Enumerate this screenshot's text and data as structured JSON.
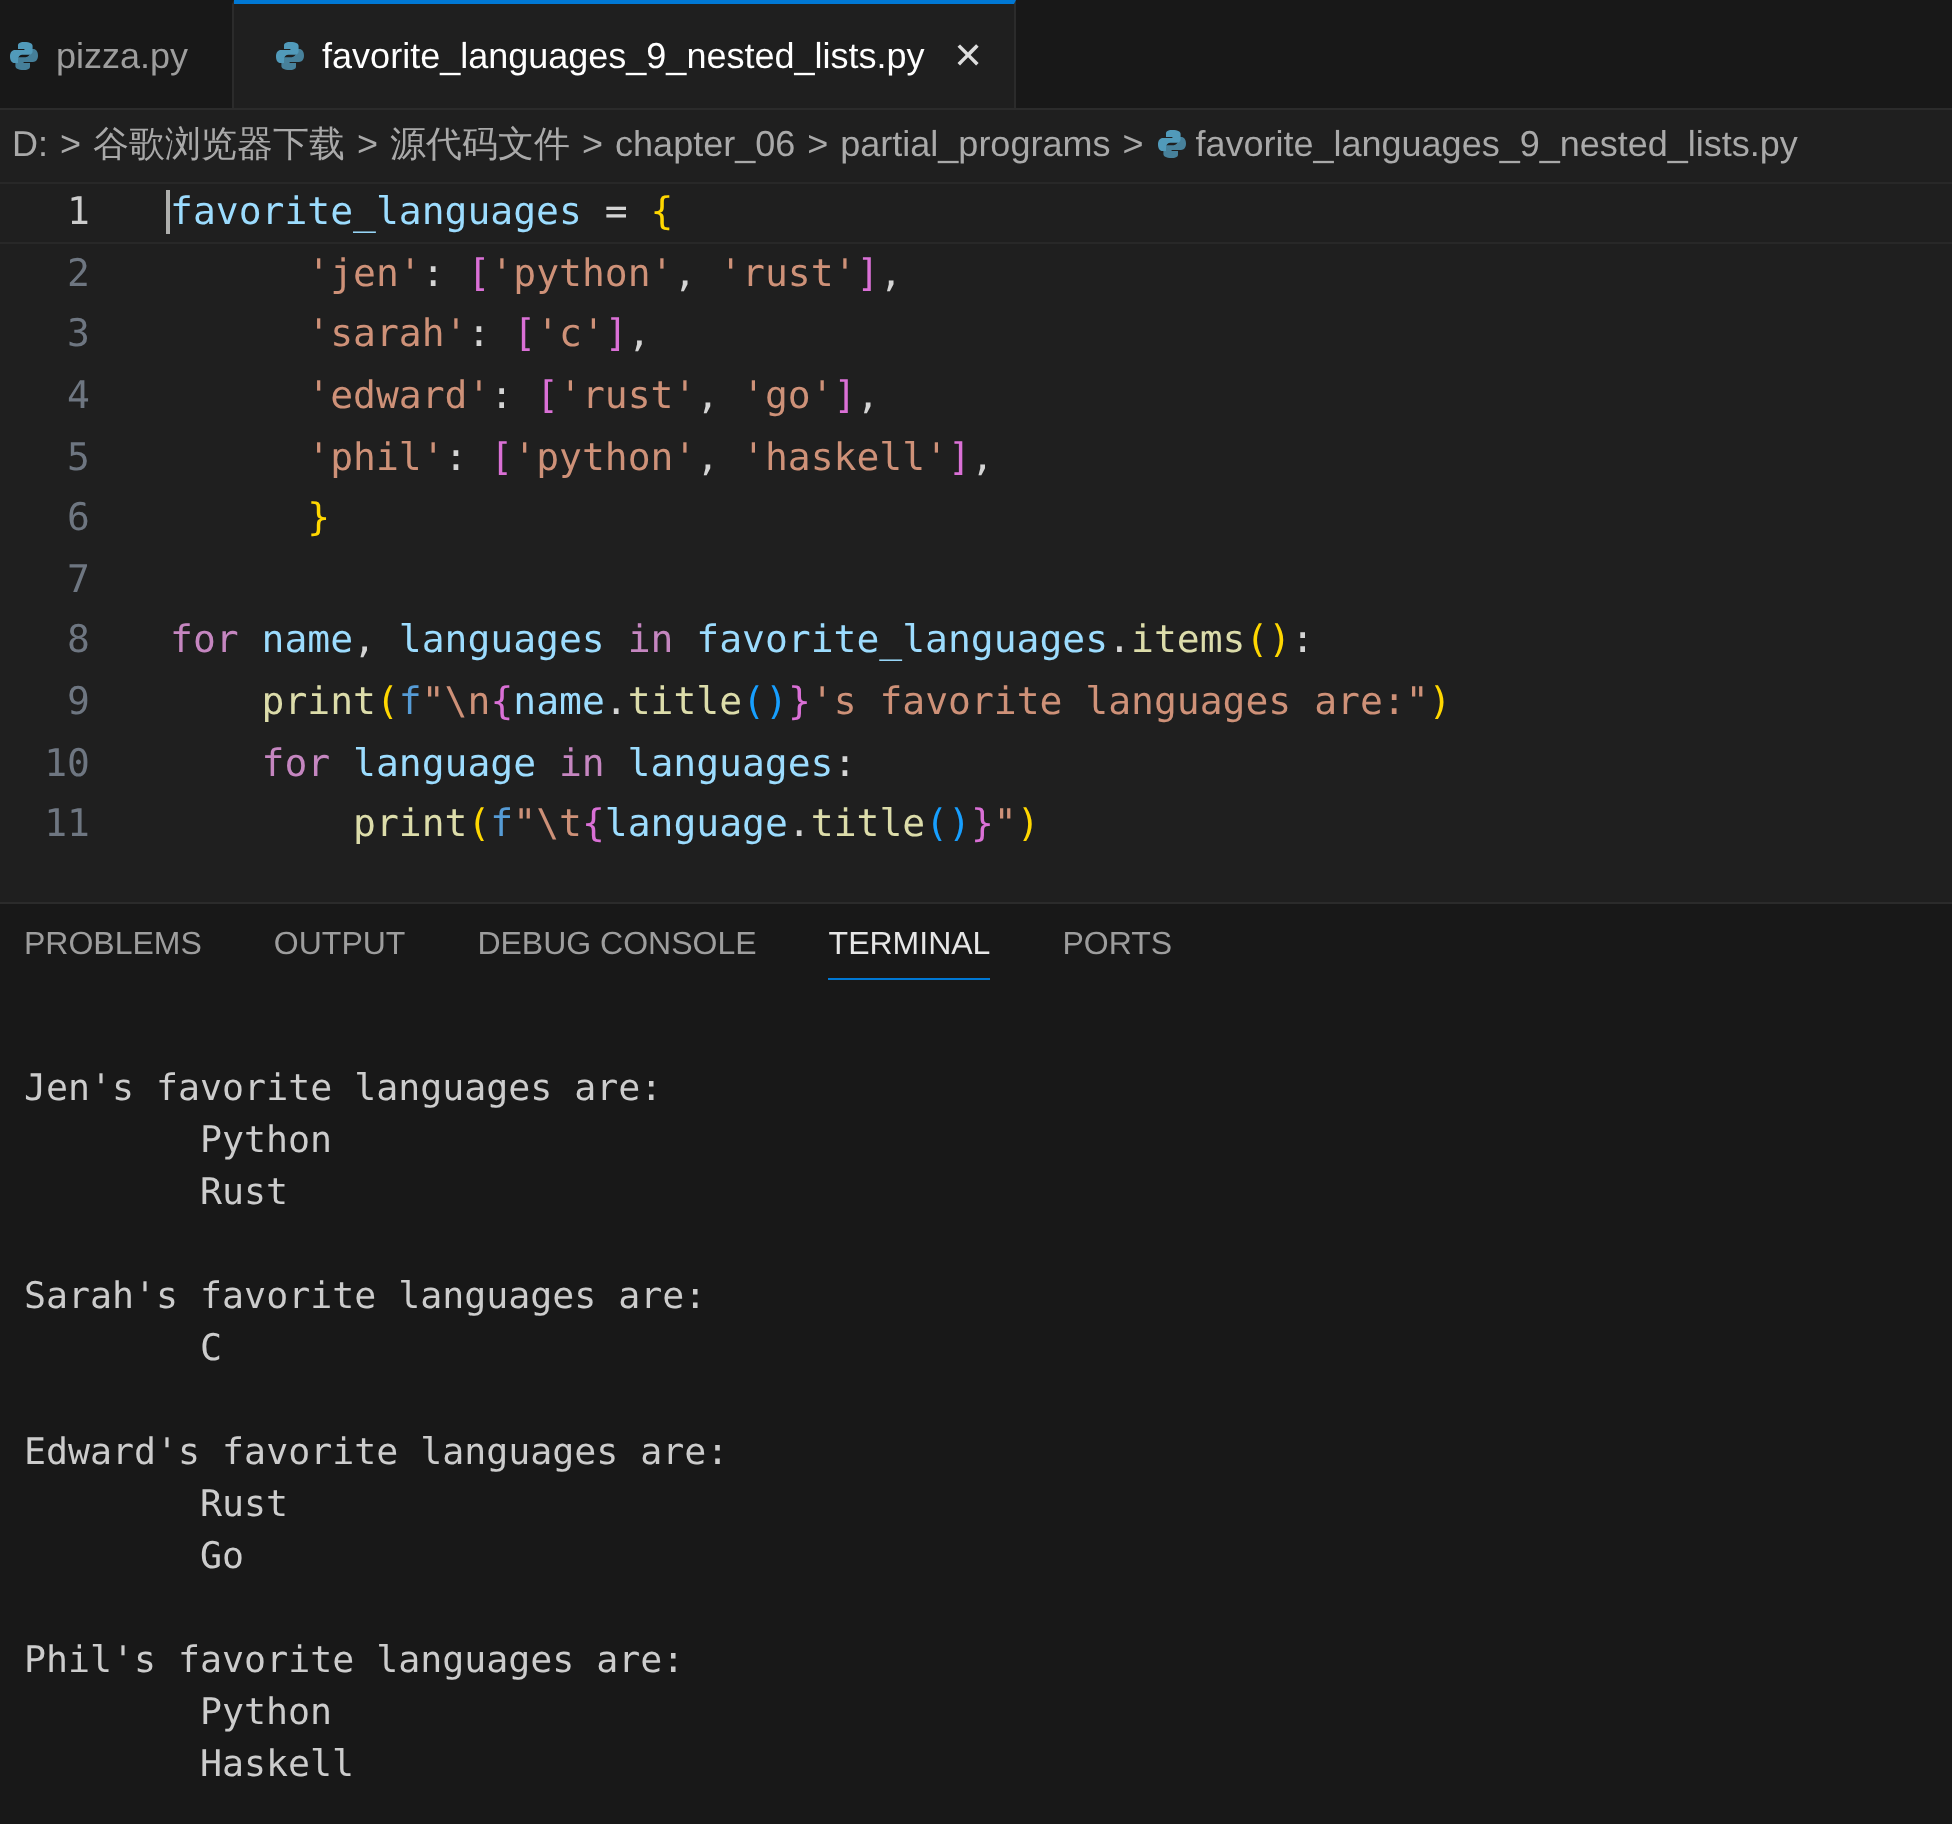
{
  "tabs": [
    {
      "label": "pizza.py",
      "selected": false
    },
    {
      "label": "favorite_languages_9_nested_lists.py",
      "selected": true,
      "close": "✕"
    }
  ],
  "breadcrumbs": [
    {
      "label": "D:",
      "kind": "folder"
    },
    {
      "label": "谷歌浏览器下载",
      "kind": "folder"
    },
    {
      "label": "源代码文件",
      "kind": "folder"
    },
    {
      "label": "chapter_06",
      "kind": "folder"
    },
    {
      "label": "partial_programs",
      "kind": "folder"
    },
    {
      "label": "favorite_languages_9_nested_lists.py",
      "kind": "file"
    }
  ],
  "breadcrumb_separator": ">",
  "editor": {
    "lines": [
      {
        "number": "1",
        "current": true,
        "tokens": [
          {
            "kind": "var",
            "text": "favorite_languages"
          },
          {
            "kind": "op",
            "text": " = "
          },
          {
            "kind": "b1",
            "text": "{"
          }
        ]
      },
      {
        "number": "2",
        "current": false,
        "tokens": [
          {
            "kind": "str",
            "text": "      'jen'"
          },
          {
            "kind": "op",
            "text": ": "
          },
          {
            "kind": "b2",
            "text": "["
          },
          {
            "kind": "str",
            "text": "'python'"
          },
          {
            "kind": "op",
            "text": ", "
          },
          {
            "kind": "str",
            "text": "'rust'"
          },
          {
            "kind": "b2",
            "text": "]"
          },
          {
            "kind": "op",
            "text": ","
          }
        ]
      },
      {
        "number": "3",
        "current": false,
        "tokens": [
          {
            "kind": "str",
            "text": "      'sarah'"
          },
          {
            "kind": "op",
            "text": ": "
          },
          {
            "kind": "b2",
            "text": "["
          },
          {
            "kind": "str",
            "text": "'c'"
          },
          {
            "kind": "b2",
            "text": "]"
          },
          {
            "kind": "op",
            "text": ","
          }
        ]
      },
      {
        "number": "4",
        "current": false,
        "tokens": [
          {
            "kind": "str",
            "text": "      'edward'"
          },
          {
            "kind": "op",
            "text": ": "
          },
          {
            "kind": "b2",
            "text": "["
          },
          {
            "kind": "str",
            "text": "'rust'"
          },
          {
            "kind": "op",
            "text": ", "
          },
          {
            "kind": "str",
            "text": "'go'"
          },
          {
            "kind": "b2",
            "text": "]"
          },
          {
            "kind": "op",
            "text": ","
          }
        ]
      },
      {
        "number": "5",
        "current": false,
        "tokens": [
          {
            "kind": "str",
            "text": "      'phil'"
          },
          {
            "kind": "op",
            "text": ": "
          },
          {
            "kind": "b2",
            "text": "["
          },
          {
            "kind": "str",
            "text": "'python'"
          },
          {
            "kind": "op",
            "text": ", "
          },
          {
            "kind": "str",
            "text": "'haskell'"
          },
          {
            "kind": "b2",
            "text": "]"
          },
          {
            "kind": "op",
            "text": ","
          }
        ]
      },
      {
        "number": "6",
        "current": false,
        "tokens": [
          {
            "kind": "b1",
            "text": "      }"
          }
        ]
      },
      {
        "number": "7",
        "current": false
      },
      {
        "number": "8",
        "current": false,
        "tokens": [
          {
            "kind": "kw",
            "text": "for "
          },
          {
            "kind": "var",
            "text": "name"
          },
          {
            "kind": "op",
            "text": ", "
          },
          {
            "kind": "var",
            "text": "languages "
          },
          {
            "kind": "kw",
            "text": "in "
          },
          {
            "kind": "var",
            "text": "favorite_languages"
          },
          {
            "kind": "op",
            "text": "."
          },
          {
            "kind": "fn",
            "text": "items"
          },
          {
            "kind": "b1",
            "text": "()"
          },
          {
            "kind": "op",
            "text": ":"
          }
        ]
      },
      {
        "number": "9",
        "current": false,
        "tokens": [
          {
            "kind": "fn",
            "text": "    print"
          },
          {
            "kind": "b1",
            "text": "("
          },
          {
            "kind": "pre",
            "text": "f"
          },
          {
            "kind": "str",
            "text": "\"\\n"
          },
          {
            "kind": "b2",
            "text": "{"
          },
          {
            "kind": "var",
            "text": "name"
          },
          {
            "kind": "op",
            "text": "."
          },
          {
            "kind": "fn",
            "text": "title"
          },
          {
            "kind": "b3",
            "text": "()"
          },
          {
            "kind": "b2",
            "text": "}"
          },
          {
            "kind": "str",
            "text": "'s favorite languages are:\""
          },
          {
            "kind": "b1",
            "text": ")"
          }
        ]
      },
      {
        "number": "10",
        "current": false,
        "tokens": [
          {
            "kind": "kw",
            "text": "    for "
          },
          {
            "kind": "var",
            "text": "language "
          },
          {
            "kind": "kw",
            "text": "in "
          },
          {
            "kind": "var",
            "text": "languages"
          },
          {
            "kind": "op",
            "text": ":"
          }
        ]
      },
      {
        "number": "11",
        "current": false,
        "tokens": [
          {
            "kind": "fn",
            "text": "        print"
          },
          {
            "kind": "b1",
            "text": "("
          },
          {
            "kind": "pre",
            "text": "f"
          },
          {
            "kind": "str",
            "text": "\"\\t"
          },
          {
            "kind": "b2",
            "text": "{"
          },
          {
            "kind": "var",
            "text": "language"
          },
          {
            "kind": "op",
            "text": "."
          },
          {
            "kind": "fn",
            "text": "title"
          },
          {
            "kind": "b3",
            "text": "()"
          },
          {
            "kind": "b2",
            "text": "}"
          },
          {
            "kind": "str",
            "text": "\""
          },
          {
            "kind": "b1",
            "text": ")"
          }
        ]
      }
    ]
  },
  "panel_tabs": [
    {
      "label": "PROBLEMS",
      "selected": false
    },
    {
      "label": "OUTPUT",
      "selected": false
    },
    {
      "label": "DEBUG CONSOLE",
      "selected": false
    },
    {
      "label": "TERMINAL",
      "selected": true
    },
    {
      "label": "PORTS",
      "selected": false
    }
  ],
  "terminal_blocks": [
    {
      "heading": "Jen's favorite languages are:",
      "items": [
        "Python",
        "Rust"
      ]
    },
    {
      "heading": "Sarah's favorite languages are:",
      "items": [
        "C"
      ]
    },
    {
      "heading": "Edward's favorite languages are:",
      "items": [
        "Rust",
        "Go"
      ]
    },
    {
      "heading": "Phil's favorite languages are:",
      "items": [
        "Python",
        "Haskell"
      ]
    }
  ]
}
